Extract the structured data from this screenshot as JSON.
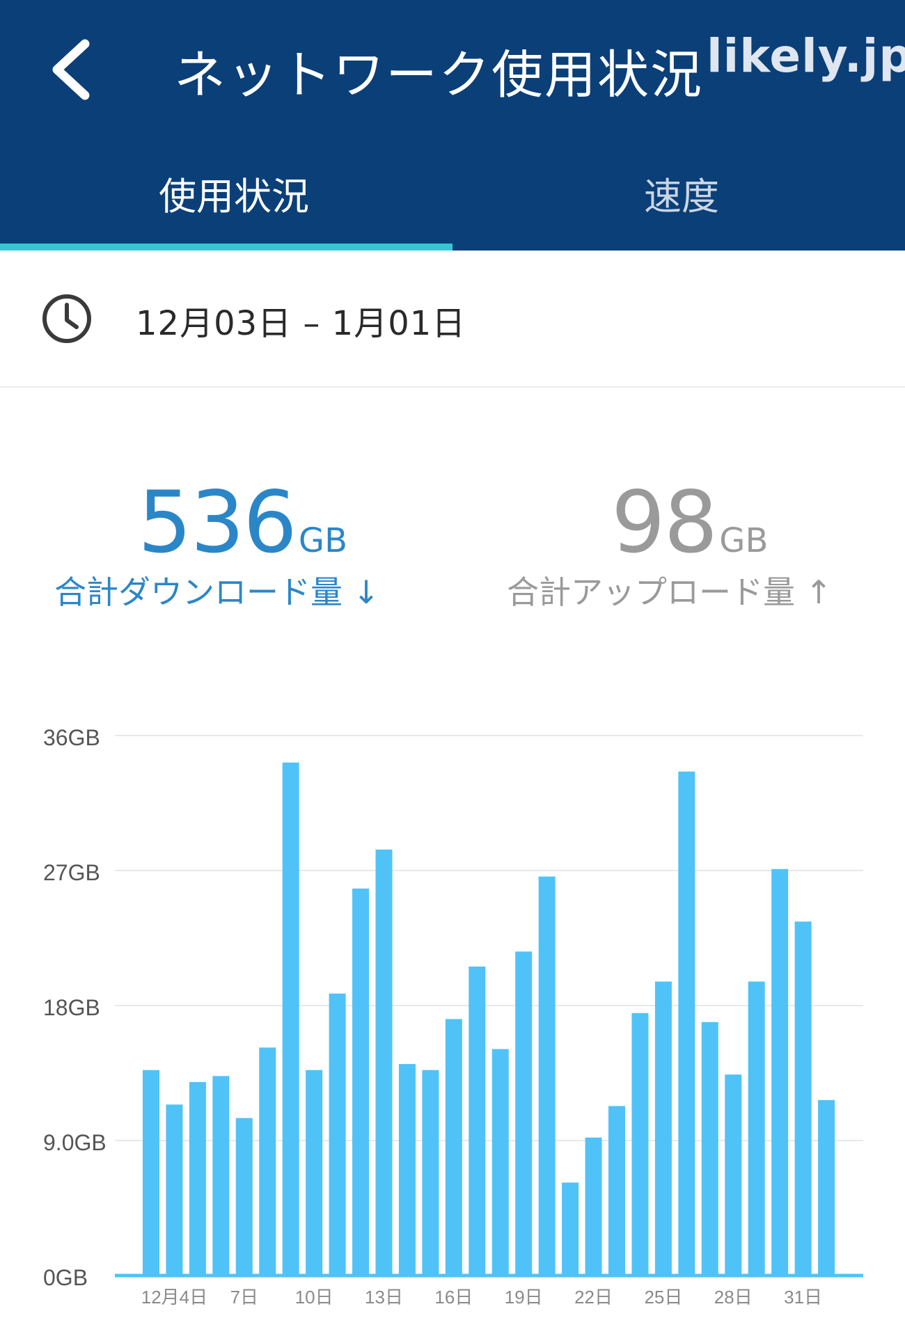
{
  "header": {
    "back_icon": "chevron-left-icon",
    "title": "ネットワーク使用状況",
    "brand": "likely.jp",
    "background": "#0b3f78"
  },
  "tabs": [
    {
      "label": "使用状況",
      "selected": true
    },
    {
      "label": "速度",
      "selected": false
    }
  ],
  "accent_color": "#37c7d3",
  "date_range": {
    "icon": "clock-icon",
    "text": "12月03日 – 1月01日"
  },
  "totals": {
    "download": {
      "value": "536",
      "unit": "GB",
      "label": "合計ダウンロード量 ↓",
      "color": "#2b86c8"
    },
    "upload": {
      "value": "98",
      "unit": "GB",
      "label": "合計アップロード量 ↑",
      "color": "#9a9a9a"
    }
  },
  "chart_data": {
    "type": "bar",
    "bar_color": "#4fc3f7",
    "ylim": [
      0,
      36
    ],
    "y_ticks": [
      {
        "value": 36,
        "label": "36GB"
      },
      {
        "value": 27,
        "label": "27GB"
      },
      {
        "value": 18,
        "label": "18GB"
      },
      {
        "value": 9,
        "label": "9.0GB"
      },
      {
        "value": 0,
        "label": "0GB"
      }
    ],
    "x_tick_labels": [
      {
        "index": 1,
        "label": "12月4日"
      },
      {
        "index": 4,
        "label": "7日"
      },
      {
        "index": 7,
        "label": "10日"
      },
      {
        "index": 10,
        "label": "13日"
      },
      {
        "index": 13,
        "label": "16日"
      },
      {
        "index": 16,
        "label": "19日"
      },
      {
        "index": 19,
        "label": "22日"
      },
      {
        "index": 22,
        "label": "25日"
      },
      {
        "index": 25,
        "label": "28日"
      },
      {
        "index": 28,
        "label": "31日"
      }
    ],
    "values": [
      13.7,
      11.4,
      12.9,
      13.3,
      10.5,
      15.2,
      34.2,
      13.7,
      18.8,
      25.8,
      28.4,
      14.1,
      13.7,
      17.1,
      20.6,
      15.1,
      21.6,
      26.6,
      6.2,
      9.2,
      11.3,
      17.5,
      19.6,
      33.6,
      16.9,
      13.4,
      19.6,
      27.1,
      23.6,
      11.7
    ],
    "grid": true
  }
}
